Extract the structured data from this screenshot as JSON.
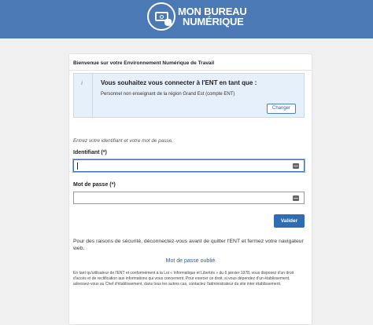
{
  "header": {
    "logo_line1": "MON BUREAU",
    "logo_line2": "NUMÉRIQUE"
  },
  "card": {
    "welcome": "Bienvenue sur votre Environnement Numérique de Travail",
    "info": {
      "icon": "i",
      "question": "Vous souhaitez vous connecter à l'ENT en tant que :",
      "profile": "Personnel non enseignant de la région Grand Est (compte ENT)",
      "change_label": "Changer"
    },
    "hint": "Entrez votre identifiant et votre mot de passe.",
    "username_label": "Identifiant  (*)",
    "username_value": "",
    "password_label": "Mot de passe (*)",
    "password_value": "",
    "submit_label": "Valider",
    "security_text": "Pour des raisons de sécurité, déconnectez-vous avant de quitter l'ENT et fermez votre navigateur web.",
    "forgot_label": "Mot de passe oublié",
    "legal_text": "En tant qu'utilisateur de l'ENT et conformément à la Loi « Informatique et Libertés » du 6 janvier 1978, vous disposez d'un droit d'accès et de rectification aux informations qui vous concernent. Pour exercer ce droit, si vous dépendez d'un établissement, adressez-vous au Chef d'établissement, dans tous les autres cas, contactez l'administrateur du site inter établissement."
  }
}
